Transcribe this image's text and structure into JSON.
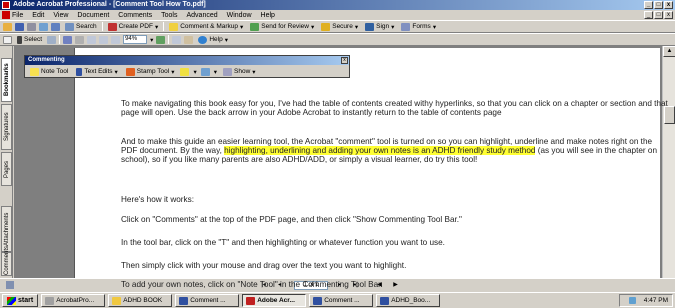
{
  "window": {
    "title": "Adobe Acrobat Professional - [Comment Tool How To.pdf]",
    "minimize": "_",
    "maximize": "□",
    "close": "x"
  },
  "menu": [
    "File",
    "Edit",
    "View",
    "Document",
    "Comments",
    "Tools",
    "Advanced",
    "Window",
    "Help"
  ],
  "toolbar1": {
    "search": "Search",
    "create_pdf": "Create PDF",
    "comment_markup": "Comment & Markup",
    "send_review": "Send for Review",
    "secure": "Secure",
    "sign": "Sign",
    "forms": "Forms"
  },
  "toolbar2": {
    "select": "Select",
    "zoom": "94%",
    "help": "Help"
  },
  "nav_tabs": [
    "Bookmarks",
    "Signatures",
    "Pages",
    "Attachments",
    "Comments"
  ],
  "commenting_toolbar": {
    "title": "Commenting",
    "note_tool": "Note Tool",
    "text_edits": "Text Edits",
    "stamp_tool": "Stamp Tool",
    "show": "Show"
  },
  "document": {
    "p1": "To make navigating this book easy for you, I've had the table of contents created withy hyperlinks, so that you can click on a chapter or section and that page will open. Use the back arrow in your Adobe Acrobat to instantly return to the table of contents page",
    "p2_a": "And to make this guide an easier learning tool, the Acrobat \"comment\" tool is turned on so you can highlight, underline and make notes right on the PDF document. By the way,",
    "p2_hl": "highlighting, underlining and adding your own notes is an ADHD friendly study method",
    "p2_b": "(as you will see in the chapter on school), so if you like many parents are also ADHD/ADD, or simply a visual learner, do try this tool!",
    "p3": "Here's how it works:",
    "p4": "Click on \"Comments\" at the top of the PDF page, and then click \"Show Commenting Tool Bar.\"",
    "p5": "In the tool bar, click on the \"T\" and then highlighting or whatever function you want to use.",
    "p6": "Then simply click with your mouse and drag over the text you want to highlight.",
    "p7": "To add your own notes, click on \"Note Tool\" in the Commenting Tool Bar."
  },
  "statusbar": {
    "page_indicator": "1 of 1"
  },
  "taskbar": {
    "start": "start",
    "tasks": [
      "AcrobatPro...",
      "ADHD BOOK",
      "Comment ...",
      "Adobe Acr...",
      "Comment ...",
      "ADHD_Boo..."
    ],
    "clock": "4:47 PM"
  },
  "colors": {
    "highlight": "#ffff33",
    "titlebar": "#0a246a"
  }
}
